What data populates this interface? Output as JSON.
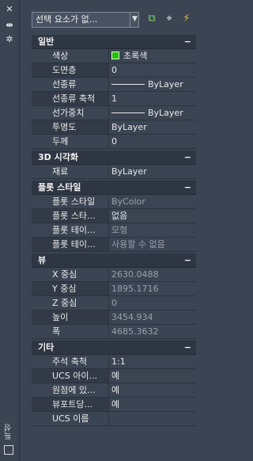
{
  "sidebar": {
    "close_icon": "close-icon",
    "pin_icon": "auto-hide-icon",
    "settings_icon": "properties-settings-icon",
    "title": "특성"
  },
  "toolbar": {
    "selector_value": "선택 요소가 없...",
    "buttons": [
      "toggle-pickadd-icon",
      "select-objects-icon",
      "quick-select-icon"
    ]
  },
  "sections": [
    {
      "title": "일반",
      "rows": [
        {
          "label": "색상",
          "value": "초록색",
          "kind": "color",
          "color": "#22c400"
        },
        {
          "label": "도면층",
          "value": "0"
        },
        {
          "label": "선종류",
          "value": "ByLayer",
          "kind": "line"
        },
        {
          "label": "선종류 축척",
          "value": "1"
        },
        {
          "label": "선가중치",
          "value": "ByLayer",
          "kind": "line"
        },
        {
          "label": "투명도",
          "value": "ByLayer"
        },
        {
          "label": "두께",
          "value": "0"
        }
      ]
    },
    {
      "title": "3D 시각화",
      "rows": [
        {
          "label": "재료",
          "value": "ByLayer"
        }
      ]
    },
    {
      "title": "플롯 스타일",
      "rows": [
        {
          "label": "플롯 스타일",
          "value": "ByColor",
          "readonly": true
        },
        {
          "label": "플롯 스타...",
          "value": "없음"
        },
        {
          "label": "플롯 테이...",
          "value": "모형",
          "readonly": true
        },
        {
          "label": "플롯 테이...",
          "value": "사용할 수 없음",
          "readonly": true
        }
      ]
    },
    {
      "title": "뷰",
      "rows": [
        {
          "label": "X 중심",
          "value": "2630.0488",
          "readonly": true
        },
        {
          "label": "Y 중심",
          "value": "1895.1716",
          "readonly": true
        },
        {
          "label": "Z 중심",
          "value": "0",
          "readonly": true
        },
        {
          "label": "높이",
          "value": "3454.934",
          "readonly": true
        },
        {
          "label": "폭",
          "value": "4685.3632",
          "readonly": true
        }
      ]
    },
    {
      "title": "기타",
      "rows": [
        {
          "label": "주석 축척",
          "value": "1:1"
        },
        {
          "label": "UCS 아이...",
          "value": "예"
        },
        {
          "label": "원점에 있...",
          "value": "예"
        },
        {
          "label": "뷰포트당...",
          "value": "예"
        },
        {
          "label": "UCS 이름",
          "value": ""
        }
      ]
    }
  ],
  "collapse_glyph": "−"
}
